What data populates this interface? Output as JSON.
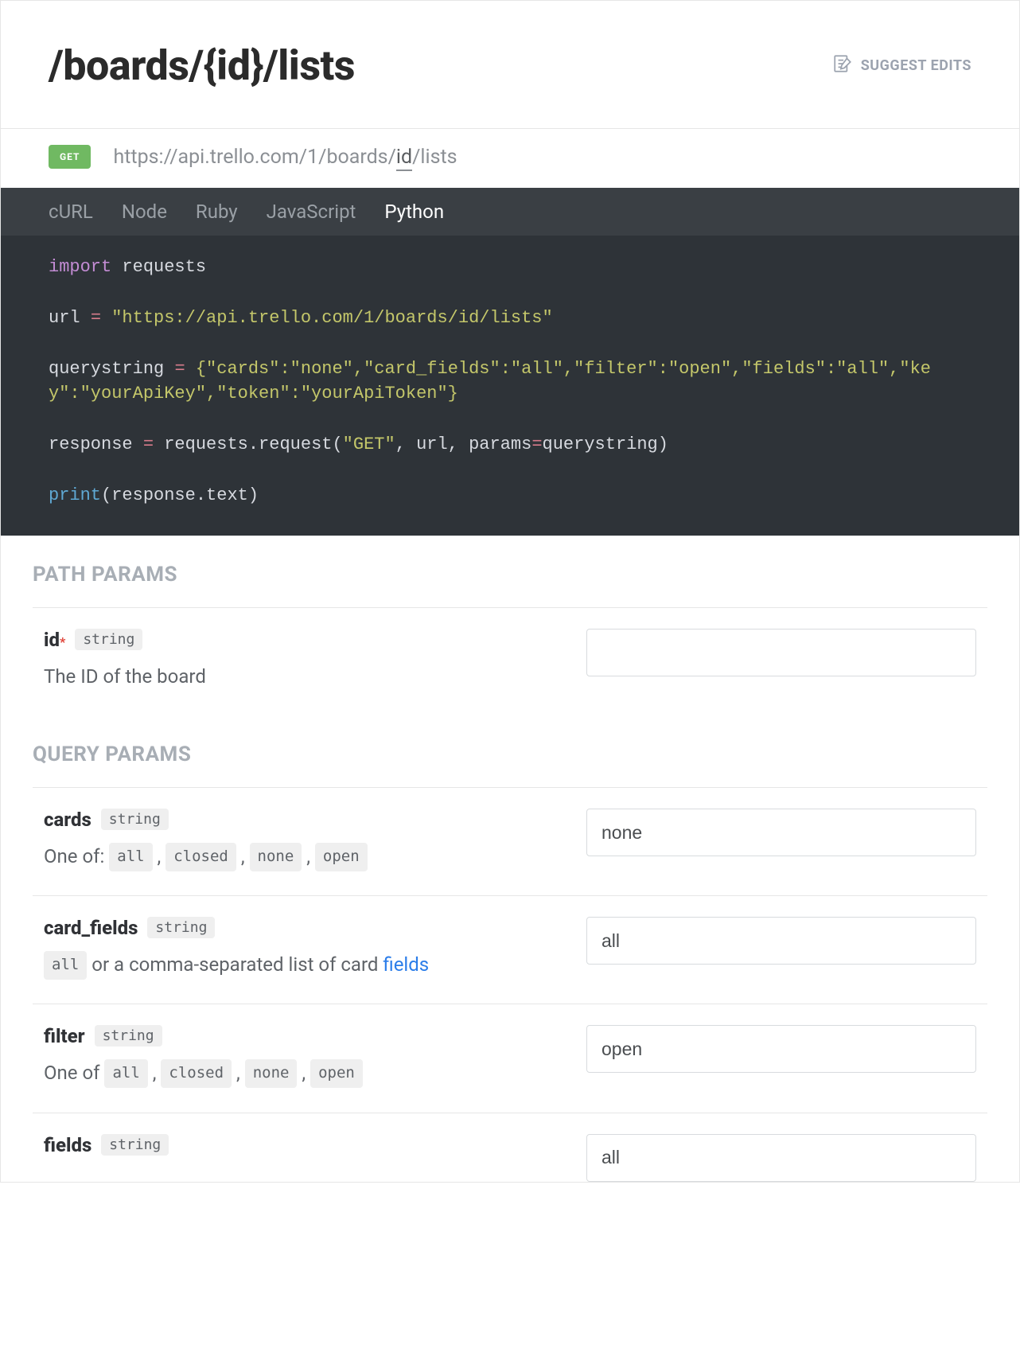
{
  "header": {
    "title": "/boards/{id}/lists",
    "suggest_edits": "SUGGEST EDITS"
  },
  "endpoint": {
    "method": "GET",
    "url_prefix": "https://api.trello.com/1/boards/",
    "url_var": "id",
    "url_suffix": "/lists"
  },
  "tabs": [
    "cURL",
    "Node",
    "Ruby",
    "JavaScript",
    "Python"
  ],
  "active_tab": "Python",
  "code": {
    "import_kw": "import",
    "import_mod": " requests",
    "url_lhs": "url ",
    "eq": "=",
    "url_val": " \"https://api.trello.com/1/boards/id/lists\"",
    "qs_lhs": "querystring ",
    "qs_val": " {\"cards\":\"none\",\"card_fields\":\"all\",\"filter\":\"open\",\"fields\":\"all\",\"key\":\"yourApiKey\",\"token\":\"yourApiToken\"}",
    "resp_lhs": "response ",
    "req_call_a": " requests.request(",
    "req_method": "\"GET\"",
    "req_call_b": ", url, params",
    "req_call_c": "querystring)",
    "print_fn": "print",
    "print_arg": "(response.text)"
  },
  "sections": {
    "path": "PATH PARAMS",
    "query": "QUERY PARAMS"
  },
  "path_params": [
    {
      "name": "id",
      "required": true,
      "type": "string",
      "desc_plain": "The ID of the board",
      "value": ""
    }
  ],
  "query_params": [
    {
      "name": "cards",
      "type": "string",
      "desc_prefix": "One of: ",
      "options": [
        "all",
        "closed",
        "none",
        "open"
      ],
      "value": "none"
    },
    {
      "name": "card_fields",
      "type": "string",
      "desc_pill": "all",
      "desc_mid": " or a comma-separated list of card ",
      "desc_link": "fields",
      "value": "all"
    },
    {
      "name": "filter",
      "type": "string",
      "desc_prefix": "One of ",
      "options": [
        "all",
        "closed",
        "none",
        "open"
      ],
      "value": "open"
    },
    {
      "name": "fields",
      "type": "string",
      "value": "all"
    }
  ]
}
